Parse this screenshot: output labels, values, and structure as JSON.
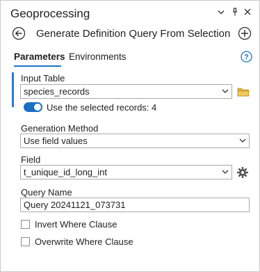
{
  "window": {
    "title": "Geoprocessing"
  },
  "tool": {
    "name": "Generate Definition Query From Selection"
  },
  "tabs": [
    {
      "label": "Parameters",
      "active": true
    },
    {
      "label": "Environments",
      "active": false
    }
  ],
  "form": {
    "input_table": {
      "label": "Input Table",
      "value": "species_records"
    },
    "use_selected": {
      "label": "Use the selected records: 4",
      "on": true
    },
    "generation_method": {
      "label": "Generation Method",
      "value": "Use field values"
    },
    "field": {
      "label": "Field",
      "value": "t_unique_id_long_int"
    },
    "query_name": {
      "label": "Query Name",
      "value": "Query 20241121_073731"
    },
    "invert_where": {
      "label": "Invert Where Clause",
      "checked": false
    },
    "overwrite_where": {
      "label": "Overwrite Where Clause",
      "checked": false
    }
  },
  "icons": {
    "chevron": "chevron-down-icon",
    "pin": "pin-icon",
    "close": "close-icon",
    "back": "back-arrow-icon",
    "add": "add-icon",
    "help": "help-icon",
    "folder": "folder-icon",
    "gear": "gear-icon"
  },
  "colors": {
    "accent": "#1a6fc4",
    "folder": "#e8b342"
  }
}
